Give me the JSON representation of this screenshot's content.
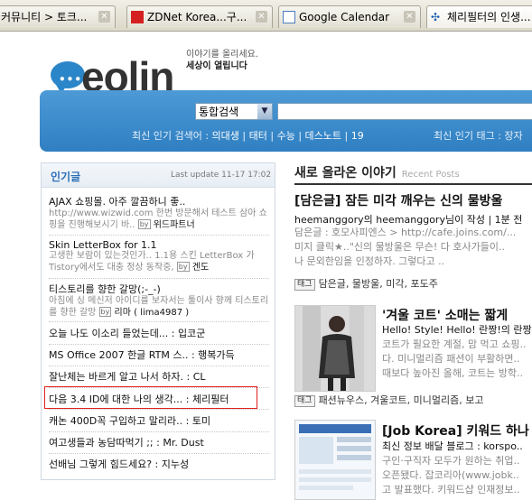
{
  "tabs": [
    {
      "label": "커뮤니티 > 토크...",
      "icon": "page-icon"
    },
    {
      "label": "ZDNet Korea...구...",
      "icon": "zdnet-icon"
    },
    {
      "label": "Google Calendar",
      "icon": "calendar-icon"
    },
    {
      "label": "체리필터의 인생...",
      "icon": "blog-icon"
    }
  ],
  "logo": {
    "text": "eolin",
    "bubble_dots": "•••"
  },
  "slogan": {
    "line1": "이야기를 올리세요.",
    "line2": "세상이 열립니다"
  },
  "search": {
    "select_value": "통합검색",
    "input_value": ""
  },
  "hot_search": {
    "label": "최신 인기 검색어 :",
    "terms": [
      "의대생",
      "태터",
      "수능",
      "데스노트",
      "19"
    ],
    "tags_label": "최신 인기 태그 : 장자"
  },
  "popular": {
    "title": "인기글",
    "updated": "Last update 11-17 17:02",
    "items": [
      {
        "title": "AJAX 쇼핑몰. 아주 깔끔하니 좋..",
        "desc": "http://www.wizwid.com 한번 방문해서 테스트 삼아 쇼핑을 진행해보시기 바..",
        "by": "위드파트너"
      },
      {
        "title": "Skin LetterBox for 1.1",
        "desc": "고생한 보람이 있는것인가.. 1.1용 스킨 LetterBox 가 Tistory에서도 대충 정상 동작중,",
        "by": "겐도"
      },
      {
        "title": "티스토리를 향한 갈망(;-_-)",
        "desc": "아침에 싱 메신저 아이디를 보자서는 툴이사 향께 티스토리를 향한 갈망",
        "by": "리마 ( lima4987 )"
      }
    ],
    "simple_items": [
      {
        "title": "오늘 나도 이소리 들었는데... :",
        "author": "입코군"
      },
      {
        "title": "MS Office 2007 한글 RTM 스.. :",
        "author": "행복가득"
      },
      {
        "title": "잘난체는 바르게 알고 나서 하자. :",
        "author": "CL"
      },
      {
        "title": "다음 3.4 ID에 대한 나의 생각... :",
        "author": "체리필터"
      },
      {
        "title": "캐논 400D꼭 구입하고 말리라.. :",
        "author": "토미"
      },
      {
        "title": "여고생들과 농담따먹기 ;; :",
        "author": "Mr. Dust"
      },
      {
        "title": "선배님 그렇게 힘드세요? :",
        "author": "지누성"
      }
    ],
    "by_label": "by"
  },
  "recent": {
    "title": "새로 올라온 이야기",
    "title_en": "Recent Posts",
    "posts": [
      {
        "title": "[담은글] 잠든 미각 깨우는 신의 물방울",
        "meta_user": "heemanggory",
        "meta_mid": "의",
        "meta_user2": "heemanggory",
        "meta_rest": "님이 작성 | 1분 전",
        "lines": [
          "담은글 : 호모사피엔스 > http://cafe.joins.com/...",
          "미지 클릭★..\"신의 물방울은 무슨! 다 호사가들이..",
          "나 문외한임을 인정하자. 그렇다고 .."
        ],
        "tag_label": "태그",
        "tags": "담은글, 물방울, 미각, 포도주"
      },
      {
        "title": "'겨울 코트' 소매는 짧게",
        "lines": [
          "Hello! Style! Hello! 란짱!의 란짱",
          "코트가 필요한 계절, 맘 먹고 쇼핑..",
          "다. 미니멀리즘 패션이 부활하면..",
          "때보다 높아진 올해, 코트는 방학.."
        ],
        "tag_label": "태그",
        "tags": "패션뉴우스, 겨울코트, 미니멀리즘, 보고"
      },
      {
        "title": "[Job Korea] 키워드 하나",
        "lines": [
          "최신 정보 배달 블로그 : korspo..",
          "구인·구직자 모두가 원하는 취업..",
          "오픈됐다. 잡코리아(www.jobk..",
          "고 발표했다. 키워드샵 인재정보.."
        ]
      }
    ]
  },
  "colors": {
    "accent": "#2f7fc2",
    "highlight": "#e02020",
    "popular_title": "#2a6fb5"
  }
}
